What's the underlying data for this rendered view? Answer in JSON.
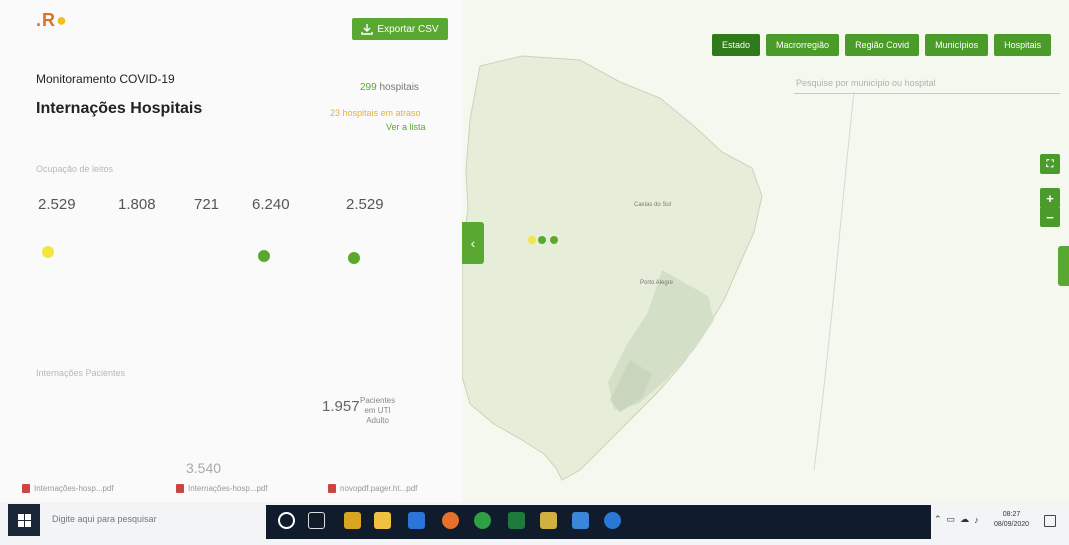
{
  "app": {
    "logo": ".R",
    "export_label": "Exportar CSV",
    "subtitle": "Monitoramento COVID-19",
    "title": "Internações Hospitais",
    "hospital_count_number": "299",
    "hospital_count_text": "hospitais",
    "hospitals_late": "23 hospitais em atraso",
    "see_list": "Ver a lista"
  },
  "section_labels": {
    "beds": "Ocupação de leitos",
    "patients": "Internações Pacientes"
  },
  "stats": [
    {
      "value": "2.529",
      "dot_color": "#f2e640"
    },
    {
      "value": "1.808",
      "dot_color": ""
    },
    {
      "value": "721",
      "dot_color": ""
    },
    {
      "value": "6.240",
      "dot_color": "#5aa82e"
    },
    {
      "value": "2.529",
      "dot_color": "#5aa82e"
    }
  ],
  "patients": {
    "value": "1.957",
    "label_line1": "Pacientes",
    "label_line2": "em UTI",
    "label_line3": "Adulto",
    "total": "3.540"
  },
  "map": {
    "tabs": [
      "Estado",
      "Macrorregião",
      "Região Covid",
      "Municípios",
      "Hospitais"
    ],
    "active_tab": "Estado",
    "search_placeholder": "Pesquise por município ou hospital",
    "cities": [
      "Caxias do Sul",
      "Porto Alegre"
    ]
  },
  "downloads": [
    {
      "label": "Internações-hosp...pdf"
    },
    {
      "label": "Internações-hosp...pdf"
    },
    {
      "label": "novopdf.pager.ht...pdf"
    }
  ],
  "taskbar": {
    "search_placeholder": "Digite aqui para pesquisar",
    "time": "08:27",
    "date": "08/09/2020"
  },
  "colors": {
    "accent": "#59a832",
    "warning": "#e3b23c",
    "taskbar": "#101c2c"
  }
}
